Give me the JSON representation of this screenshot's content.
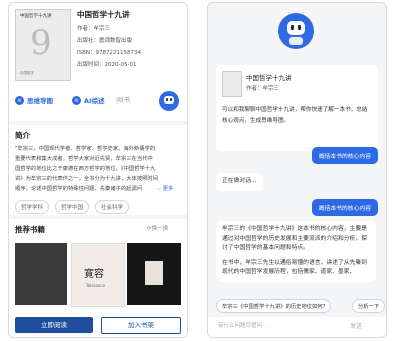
{
  "left": {
    "book": {
      "cover_title": "中国哲学十九讲",
      "cover_number": "9",
      "cover_publisher": "中国哲学",
      "title": "中国哲学十九讲",
      "author": "作者：牟宗三",
      "publisher": "出版社：震颂数智出版",
      "isbn": "ISBN：9787221158734",
      "date": "出版时间：2020-05-01"
    },
    "actions": {
      "mindmap": "思维导图",
      "ai_summary": "AI综述",
      "listen": "|听书"
    },
    "intro": {
      "heading": "简介",
      "lines": [
        "\"牟宗三，中国现代学者、哲学家、哲学史家。海外新儒学的",
        "重要代表和集大成者。哲学大家对近先贤，牟宗三在当代中",
        "国哲学的地位比之于康德在西方哲学的地位。《中国哲学十九",
        "讲》为牟宗三的代表作之一，全书分为十九讲，大体按照时间",
        "顺序，论述中国哲学的特殊性问题、先秦诸子的起源问"
      ],
      "more": "更多",
      "tags": [
        "哲学学科",
        "哲学中国",
        "社会科学"
      ]
    },
    "recommend": {
      "heading": "推荐书籍",
      "refresh": "换一换",
      "book2_title": "寛容",
      "book2_sub": "Tolerance"
    },
    "bottom": {
      "read": "立即阅读",
      "shelf": "加入书架"
    }
  },
  "right": {
    "book_title": "中国哲学十九讲",
    "book_author": "作者：牟宗三",
    "greeting": "可以和我聊聊中国哲学十九讲，帮你快速了解一本书，总结核心观点，生成思维导图。",
    "user_msg1": "概括本书的核心内容",
    "thinking": "正在做对话...",
    "user_msg2": "概括本书的核心内容",
    "answer1": "牟宗三的《中国哲学十九讲》这本书的核心内容，主要是通过对中国哲学的历史发展和主要流派的介绍和分析，探讨了中国哲学的基本问题和特点。",
    "answer2": "在书中，牟宗三先生以通俗易懂的语言，讲述了从先秦到现代的中国哲学发展历程，包括儒家、道家、墨家、",
    "suggest1": "牟宗三《中国哲学十九讲》的历史地位如何?",
    "suggest2": "分析一下",
    "input_placeholder": "有什么问题尽管问...",
    "send": "发送"
  },
  "colors": {
    "accent": "#2d6be4",
    "dark_button": "#1f4e9c"
  }
}
